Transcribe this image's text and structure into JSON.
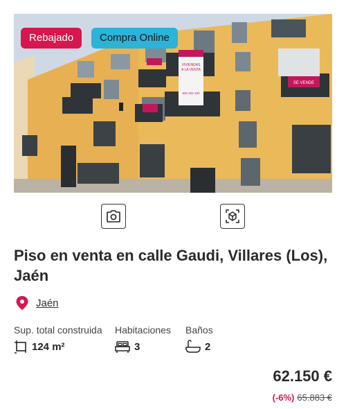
{
  "badges": {
    "reduced": "Rebajado",
    "online": "Compra Online"
  },
  "photo": {
    "alt": "Fachada del edificio",
    "building_banner": [
      "VIVIENDAS",
      "A LA VENTA",
      "900 322 100"
    ],
    "sign_text": "SE VENDE"
  },
  "media_buttons": {
    "photos_icon": "camera-icon",
    "tour_icon": "3d-cube-icon"
  },
  "listing": {
    "title": "Piso en venta en calle Gaudi, Villares (Los), Jaén",
    "location": "Jaén",
    "features": [
      {
        "label": "Sup. total construida",
        "value": "124 m²",
        "icon": "area-icon"
      },
      {
        "label": "Habitaciones",
        "value": "3",
        "icon": "bed-icon"
      },
      {
        "label": "Baños",
        "value": "2",
        "icon": "bath-icon"
      }
    ],
    "price": "62.150 €",
    "discount": "(-6%)",
    "old_price": "65.883 €"
  },
  "colors": {
    "brand": "#d6164d",
    "online_badge": "#2bb3d9"
  }
}
